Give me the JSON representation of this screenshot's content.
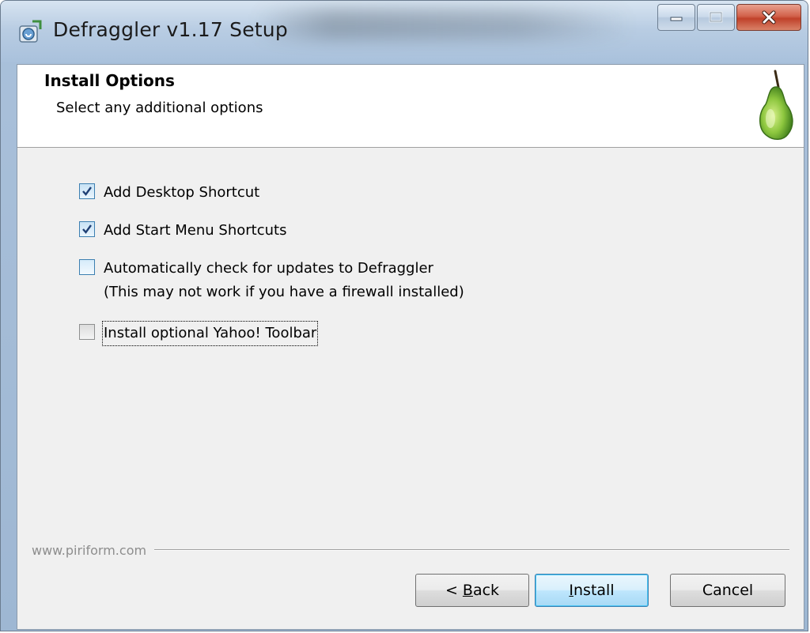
{
  "window": {
    "title": "Defraggler v1.17 Setup"
  },
  "header": {
    "title": "Install Options",
    "subtitle": "Select any additional options"
  },
  "options": [
    {
      "label": "Add Desktop Shortcut",
      "checked": true
    },
    {
      "label": "Add Start Menu Shortcuts",
      "checked": true
    },
    {
      "label": "Automatically check for updates to Defraggler",
      "note": "(This may not work if you have a firewall installed)",
      "checked": false
    },
    {
      "label": "Install optional Yahoo! Toolbar",
      "checked": false
    }
  ],
  "footer": {
    "brand": "www.piriform.com"
  },
  "buttons": {
    "back_prefix": "< ",
    "back_accel": "B",
    "back_rest": "ack",
    "install_accel": "I",
    "install_rest": "nstall",
    "cancel": "Cancel"
  },
  "icons": {
    "app": "setup-app-icon",
    "logo": "pear-logo-icon",
    "checkmark": "checkmark-icon",
    "minimize": "minimize-icon",
    "maximize": "maximize-icon",
    "close": "close-icon"
  },
  "colors": {
    "accent": "#3c7fb1",
    "close_button": "#c0412a",
    "pear_green": "#8cc63e"
  }
}
